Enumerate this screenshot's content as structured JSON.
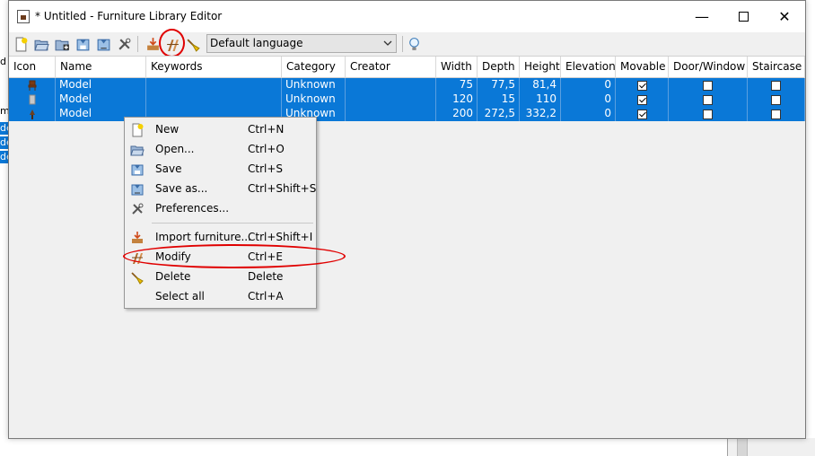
{
  "window": {
    "title": "* Untitled - Furniture Library Editor",
    "minimize_glyph": "—",
    "close_glyph": "✕"
  },
  "toolbar": {
    "buttons": [
      {
        "name": "new-icon"
      },
      {
        "name": "open-icon"
      },
      {
        "name": "merge-icon"
      },
      {
        "name": "save-icon"
      },
      {
        "name": "save-as-icon"
      },
      {
        "name": "preferences-icon"
      },
      {
        "name": "import-furniture-icon"
      },
      {
        "name": "modify-icon"
      },
      {
        "name": "delete-icon"
      },
      {
        "name": "tips-icon"
      }
    ],
    "language": "Default language"
  },
  "table": {
    "columns": [
      "Icon",
      "Name",
      "Keywords",
      "Category",
      "Creator",
      "Width",
      "Depth",
      "Height",
      "Elevation",
      "Movable",
      "Door/Window",
      "Staircase"
    ],
    "rows": [
      {
        "name": "Model",
        "keywords": "",
        "category": "Unknown",
        "creator": "",
        "width": "75",
        "depth": "77,5",
        "height": "81,4",
        "elevation": "0",
        "movable": true,
        "door_window": false,
        "staircase": false
      },
      {
        "name": "Model",
        "keywords": "",
        "category": "Unknown",
        "creator": "",
        "width": "120",
        "depth": "15",
        "height": "110",
        "elevation": "0",
        "movable": true,
        "door_window": false,
        "staircase": false
      },
      {
        "name": "Model",
        "keywords": "",
        "category": "Unknown",
        "creator": "",
        "width": "200",
        "depth": "272,5",
        "height": "332,2",
        "elevation": "0",
        "movable": true,
        "door_window": false,
        "staircase": false
      }
    ]
  },
  "context_menu": {
    "items": [
      {
        "label": "New",
        "shortcut": "Ctrl+N"
      },
      {
        "label": "Open...",
        "shortcut": "Ctrl+O"
      },
      {
        "label": "Save",
        "shortcut": "Ctrl+S"
      },
      {
        "label": "Save as...",
        "shortcut": "Ctrl+Shift+S"
      },
      {
        "label": "Preferences...",
        "shortcut": ""
      },
      {
        "label": "Import furniture...",
        "shortcut": "Ctrl+Shift+I"
      },
      {
        "label": "Modify",
        "shortcut": "Ctrl+E"
      },
      {
        "label": "Delete",
        "shortcut": "Delete"
      },
      {
        "label": "Select all",
        "shortcut": "Ctrl+A"
      }
    ]
  },
  "background": {
    "left_fragments": [
      "d",
      "m",
      "de",
      "de",
      "de"
    ]
  },
  "colors": {
    "selection": "#0a78d7",
    "annotation": "#e00000"
  }
}
